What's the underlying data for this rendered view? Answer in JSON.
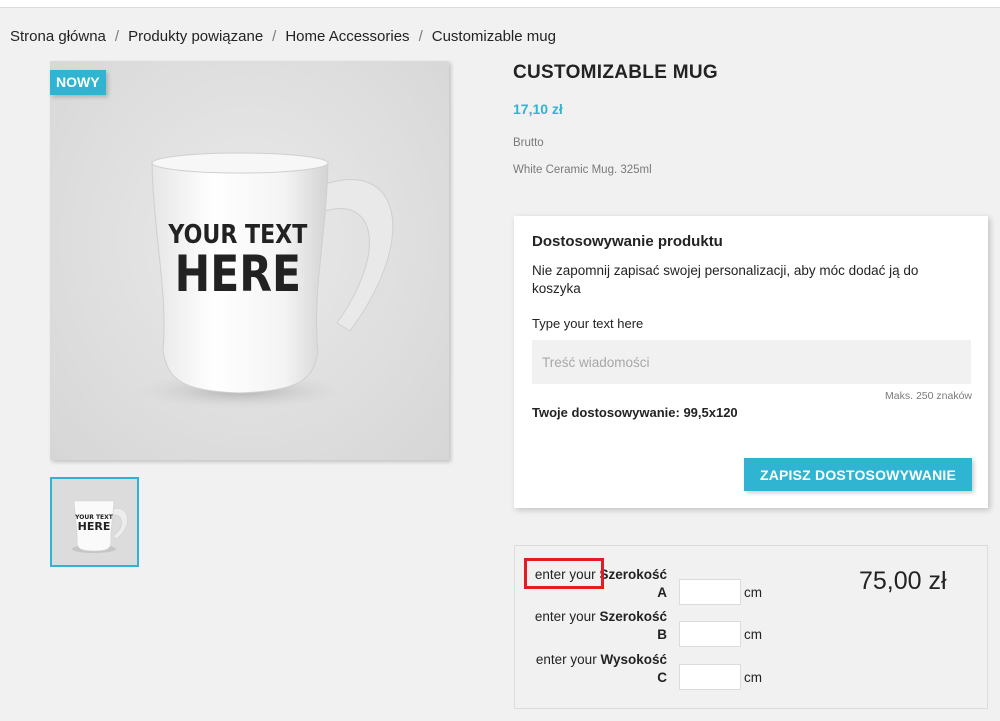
{
  "breadcrumb": {
    "items": [
      "Strona główna",
      "Produkty powiązane",
      "Home Accessories",
      "Customizable mug"
    ],
    "separator": "/"
  },
  "badge": {
    "label": "NOWY"
  },
  "product": {
    "title": "CUSTOMIZABLE MUG",
    "price": "17,10 zł",
    "tax_label": "Brutto",
    "short_description": "White Ceramic Mug. 325ml",
    "image_text": [
      "YOUR TEXT",
      "HERE"
    ]
  },
  "customization": {
    "title": "Dostosowywanie produktu",
    "note": "Nie zapomnij zapisać swojej personalizacji, aby móc dodać ją do koszyka",
    "field_label": "Type your text here",
    "placeholder": "Treść wiadomości",
    "max_chars": "Maks. 250 znaków",
    "your_customization": "Twoje dostosowywanie: 99,5x120",
    "save_label": "ZAPISZ DOSTOSOWYWANIE"
  },
  "dimensions": {
    "rows": [
      {
        "prefix": "enter your",
        "name": "Szerokość",
        "code": "A",
        "unit": "cm",
        "value": ""
      },
      {
        "prefix": "enter your",
        "name": "Szerokość",
        "code": "B",
        "unit": "cm",
        "value": ""
      },
      {
        "prefix": "enter your",
        "name": "Wysokość",
        "code": "C",
        "unit": "cm",
        "value": ""
      }
    ],
    "total_price": "75,00 zł"
  },
  "colors": {
    "accent": "#2fb5d2",
    "highlight": "#e31b23",
    "background": "#f1f1f1"
  }
}
